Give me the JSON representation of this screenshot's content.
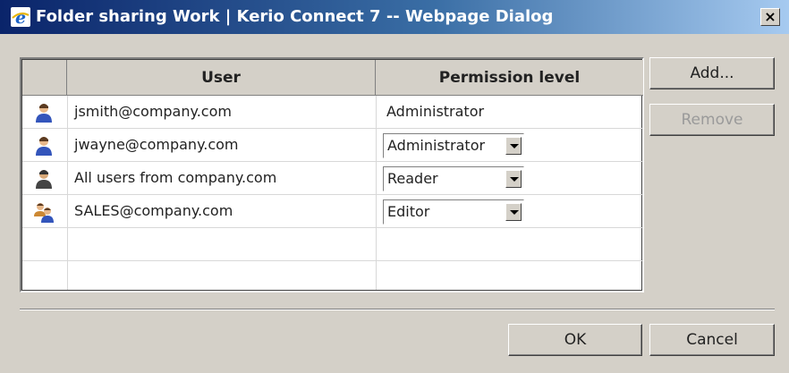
{
  "window": {
    "title": "Folder sharing Work | Kerio Connect 7 -- Webpage Dialog",
    "close_glyph": "×"
  },
  "table": {
    "columns": {
      "user": "User",
      "permission": "Permission level"
    },
    "rows": [
      {
        "user": "jsmith@company.com",
        "permission": "Administrator",
        "editable": false,
        "icon": "user-icon"
      },
      {
        "user": "jwayne@company.com",
        "permission": "Administrator",
        "editable": true,
        "icon": "user-icon"
      },
      {
        "user": "All users from company.com",
        "permission": "Reader",
        "editable": true,
        "icon": "user-icon-dark"
      },
      {
        "user": "SALES@company.com",
        "permission": "Editor",
        "editable": true,
        "icon": "group-icon"
      }
    ]
  },
  "buttons": {
    "add": "Add...",
    "remove": "Remove",
    "ok": "OK",
    "cancel": "Cancel"
  },
  "colors": {
    "titlebar": "#0a246a",
    "face": "#d4d0c8",
    "disabled": "#9a9a9a"
  }
}
